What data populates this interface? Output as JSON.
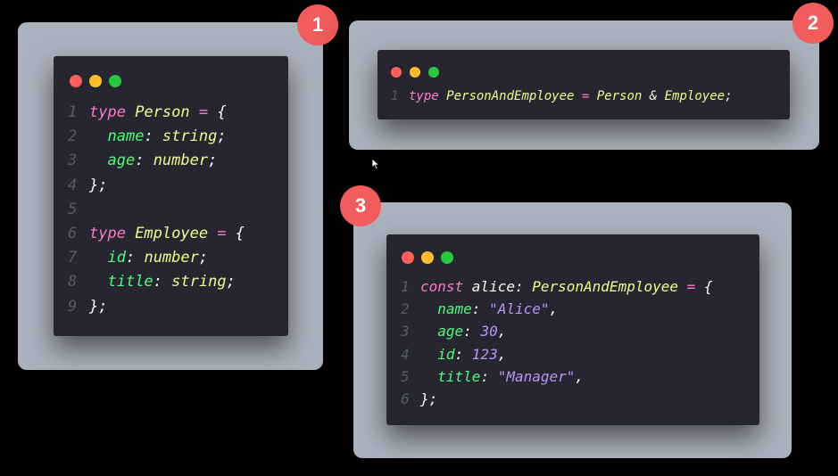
{
  "badges": [
    "1",
    "2",
    "3"
  ],
  "panel1": {
    "lines": [
      {
        "n": "1",
        "t": [
          {
            "c": "kw",
            "v": "type "
          },
          {
            "c": "ty",
            "v": "Person"
          },
          {
            "c": "op",
            "v": " = "
          },
          {
            "c": "pu",
            "v": "{"
          }
        ]
      },
      {
        "n": "2",
        "t": [
          {
            "c": "pu",
            "v": "  "
          },
          {
            "c": "pr",
            "v": "name"
          },
          {
            "c": "pu",
            "v": ": "
          },
          {
            "c": "ty",
            "v": "string"
          },
          {
            "c": "pu",
            "v": ";"
          }
        ]
      },
      {
        "n": "3",
        "t": [
          {
            "c": "pu",
            "v": "  "
          },
          {
            "c": "pr",
            "v": "age"
          },
          {
            "c": "pu",
            "v": ": "
          },
          {
            "c": "ty",
            "v": "number"
          },
          {
            "c": "pu",
            "v": ";"
          }
        ]
      },
      {
        "n": "4",
        "t": [
          {
            "c": "pu",
            "v": "};"
          }
        ]
      },
      {
        "n": "5",
        "t": []
      },
      {
        "n": "6",
        "t": [
          {
            "c": "kw",
            "v": "type "
          },
          {
            "c": "ty",
            "v": "Employee"
          },
          {
            "c": "op",
            "v": " = "
          },
          {
            "c": "pu",
            "v": "{"
          }
        ]
      },
      {
        "n": "7",
        "t": [
          {
            "c": "pu",
            "v": "  "
          },
          {
            "c": "pr",
            "v": "id"
          },
          {
            "c": "pu",
            "v": ": "
          },
          {
            "c": "ty",
            "v": "number"
          },
          {
            "c": "pu",
            "v": ";"
          }
        ]
      },
      {
        "n": "8",
        "t": [
          {
            "c": "pu",
            "v": "  "
          },
          {
            "c": "pr",
            "v": "title"
          },
          {
            "c": "pu",
            "v": ": "
          },
          {
            "c": "ty",
            "v": "string"
          },
          {
            "c": "pu",
            "v": ";"
          }
        ]
      },
      {
        "n": "9",
        "t": [
          {
            "c": "pu",
            "v": "};"
          }
        ]
      }
    ]
  },
  "panel2": {
    "lines": [
      {
        "n": "1",
        "t": [
          {
            "c": "kw",
            "v": "type "
          },
          {
            "c": "ty",
            "v": "PersonAndEmployee"
          },
          {
            "c": "op",
            "v": " = "
          },
          {
            "c": "ty",
            "v": "Person"
          },
          {
            "c": "pu",
            "v": " & "
          },
          {
            "c": "ty",
            "v": "Employee"
          },
          {
            "c": "pu",
            "v": ";"
          }
        ]
      }
    ]
  },
  "panel3": {
    "lines": [
      {
        "n": "1",
        "t": [
          {
            "c": "kw",
            "v": "const "
          },
          {
            "c": "va",
            "v": "alice"
          },
          {
            "c": "pu",
            "v": ": "
          },
          {
            "c": "ty",
            "v": "PersonAndEmployee"
          },
          {
            "c": "op",
            "v": " = "
          },
          {
            "c": "pu",
            "v": "{"
          }
        ]
      },
      {
        "n": "2",
        "t": [
          {
            "c": "pu",
            "v": "  "
          },
          {
            "c": "pr",
            "v": "name"
          },
          {
            "c": "pu",
            "v": ": "
          },
          {
            "c": "st",
            "v": "\"Alice\""
          },
          {
            "c": "pu",
            "v": ","
          }
        ]
      },
      {
        "n": "3",
        "t": [
          {
            "c": "pu",
            "v": "  "
          },
          {
            "c": "pr",
            "v": "age"
          },
          {
            "c": "pu",
            "v": ": "
          },
          {
            "c": "nu",
            "v": "30"
          },
          {
            "c": "pu",
            "v": ","
          }
        ]
      },
      {
        "n": "4",
        "t": [
          {
            "c": "pu",
            "v": "  "
          },
          {
            "c": "pr",
            "v": "id"
          },
          {
            "c": "pu",
            "v": ": "
          },
          {
            "c": "nu",
            "v": "123"
          },
          {
            "c": "pu",
            "v": ","
          }
        ]
      },
      {
        "n": "5",
        "t": [
          {
            "c": "pu",
            "v": "  "
          },
          {
            "c": "pr",
            "v": "title"
          },
          {
            "c": "pu",
            "v": ": "
          },
          {
            "c": "st",
            "v": "\"Manager\""
          },
          {
            "c": "pu",
            "v": ","
          }
        ]
      },
      {
        "n": "6",
        "t": [
          {
            "c": "pu",
            "v": "};"
          }
        ]
      }
    ]
  }
}
